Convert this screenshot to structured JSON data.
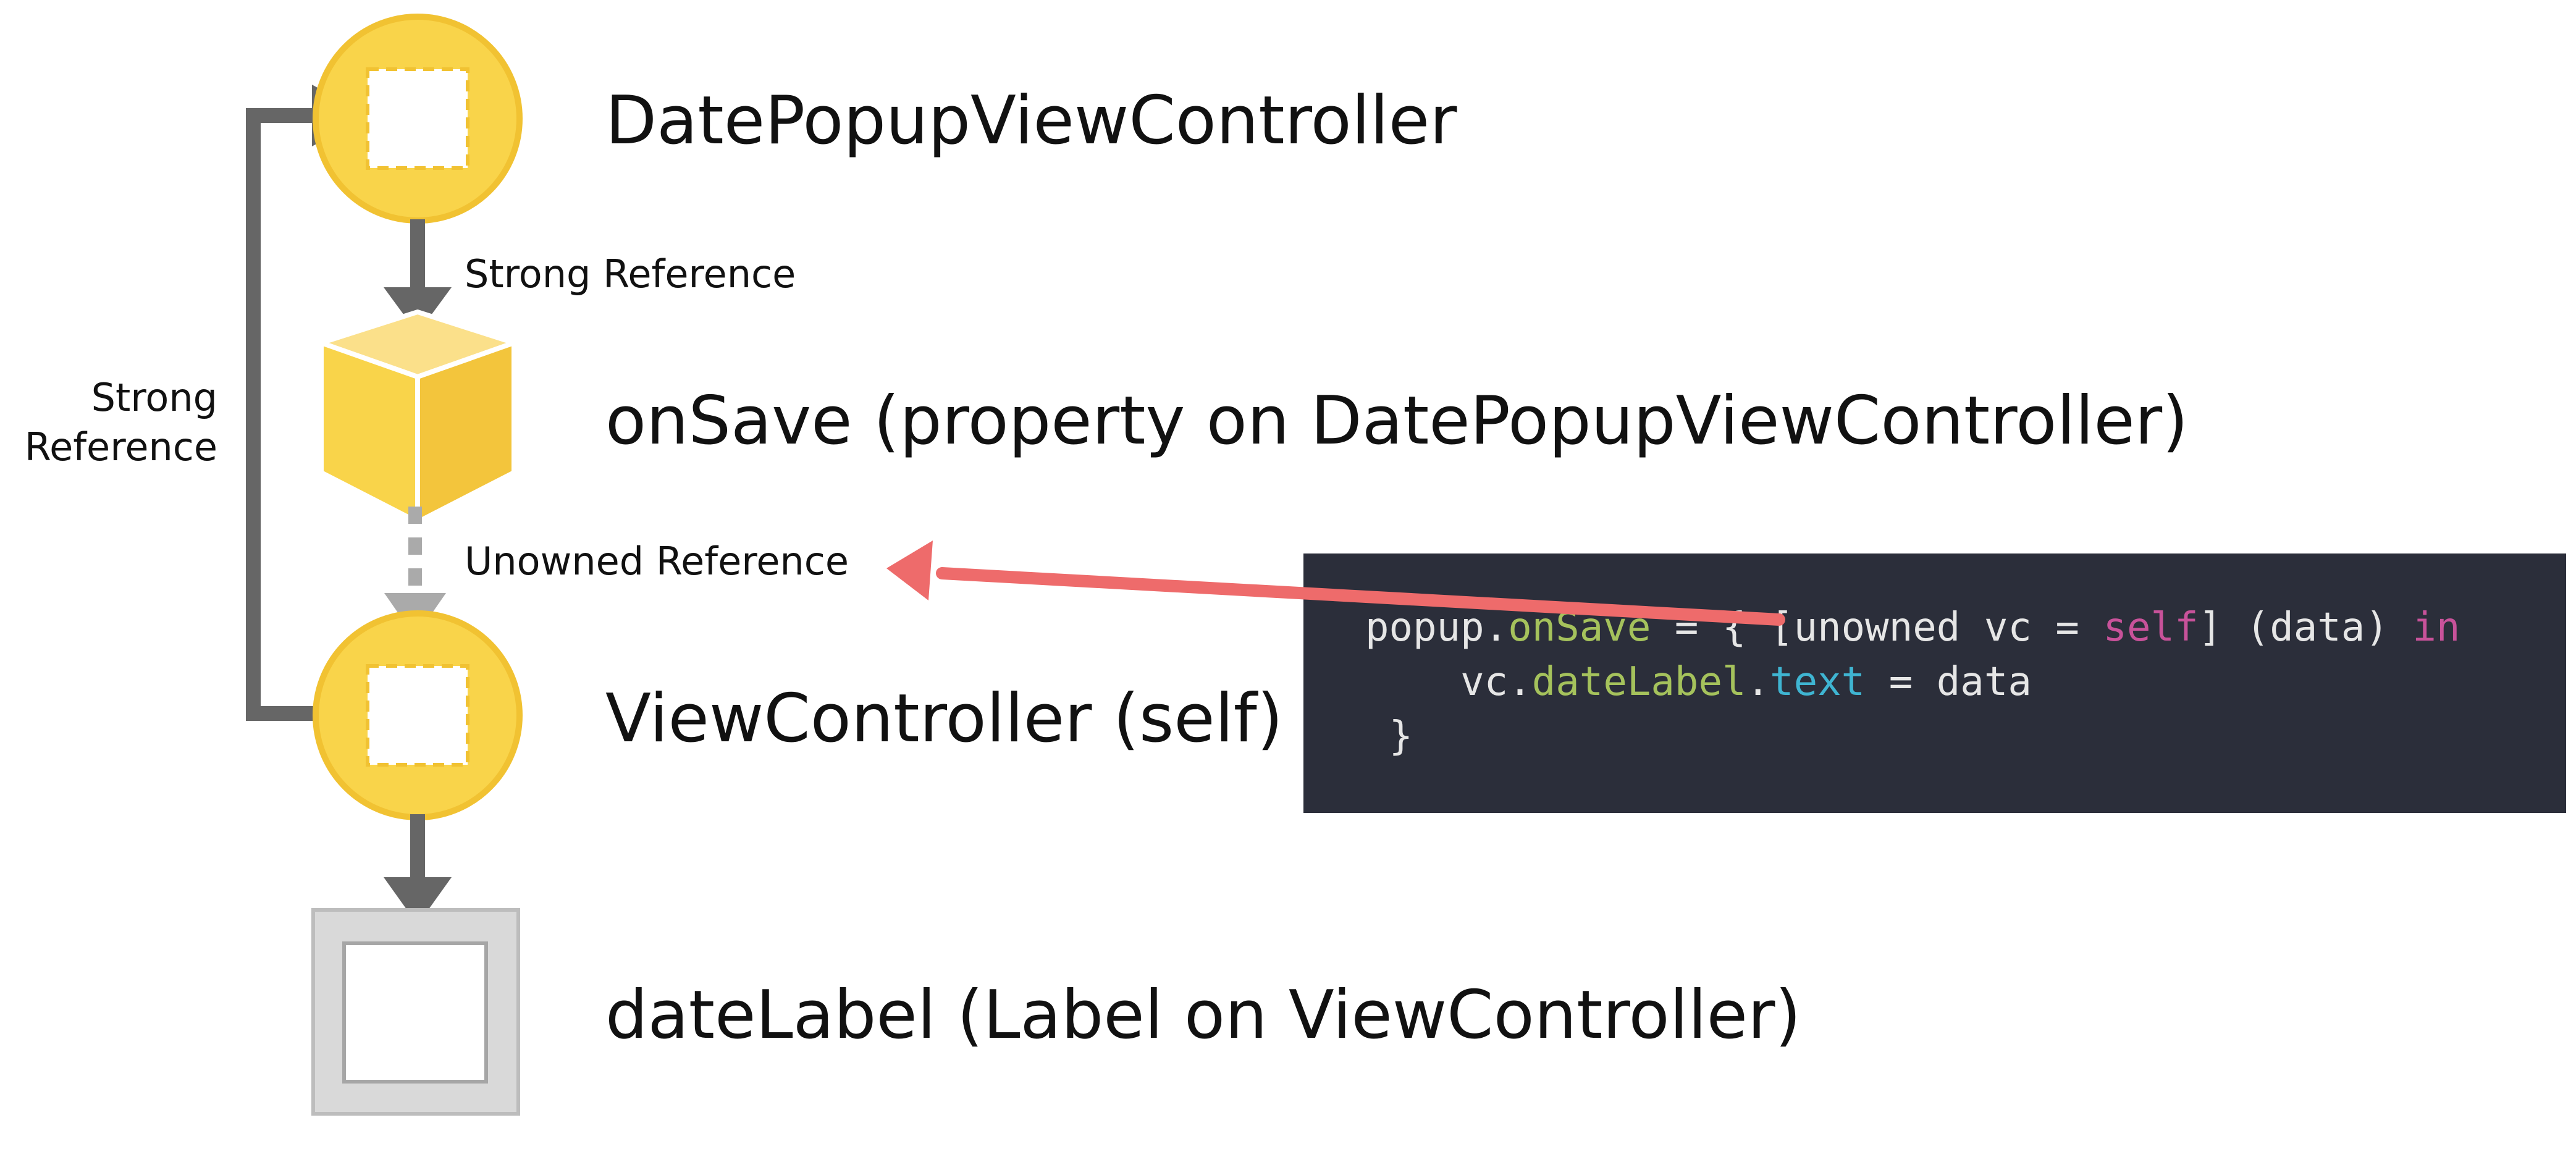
{
  "nodes": {
    "date_popup_vc": {
      "label": "DatePopupViewController"
    },
    "on_save": {
      "label": "onSave (property on DatePopupViewController)"
    },
    "view_controller": {
      "label": "ViewController (self)"
    },
    "date_label": {
      "label": "dateLabel (Label on ViewController)"
    }
  },
  "edges": {
    "popup_to_onsave": {
      "label": "Strong Reference",
      "style": "solid"
    },
    "onsave_to_vc": {
      "label": "Unowned Reference",
      "style": "dashed"
    },
    "vc_to_popup": {
      "label_line1": "Strong",
      "label_line2": "Reference",
      "style": "solid"
    },
    "vc_to_datelabel": {
      "style": "solid"
    }
  },
  "code": {
    "line1": {
      "t1": "popup.",
      "t2": "onSave",
      "t3": " = { [unowned vc = ",
      "t4": "self",
      "t5": "] (data) ",
      "t6": "in"
    },
    "line2": {
      "t1": "    vc.",
      "t2": "dateLabel",
      "t3": ".",
      "t4": "text",
      "t5": " = data"
    },
    "line3": {
      "t1": " }"
    }
  },
  "colors": {
    "node_fill": "#f9d44a",
    "node_stroke": "#f1c232",
    "arrow": "#666666",
    "dashed_arrow": "#aaaaaa",
    "highlight_arrow": "#ee6b6b",
    "code_background": "#2b2e3a",
    "label_box": "#d9d9d9"
  },
  "icons": {
    "object_node": "circle-with-dashed-square-icon",
    "property_node": "cube-icon",
    "ui_label_node": "square-frame-icon"
  }
}
